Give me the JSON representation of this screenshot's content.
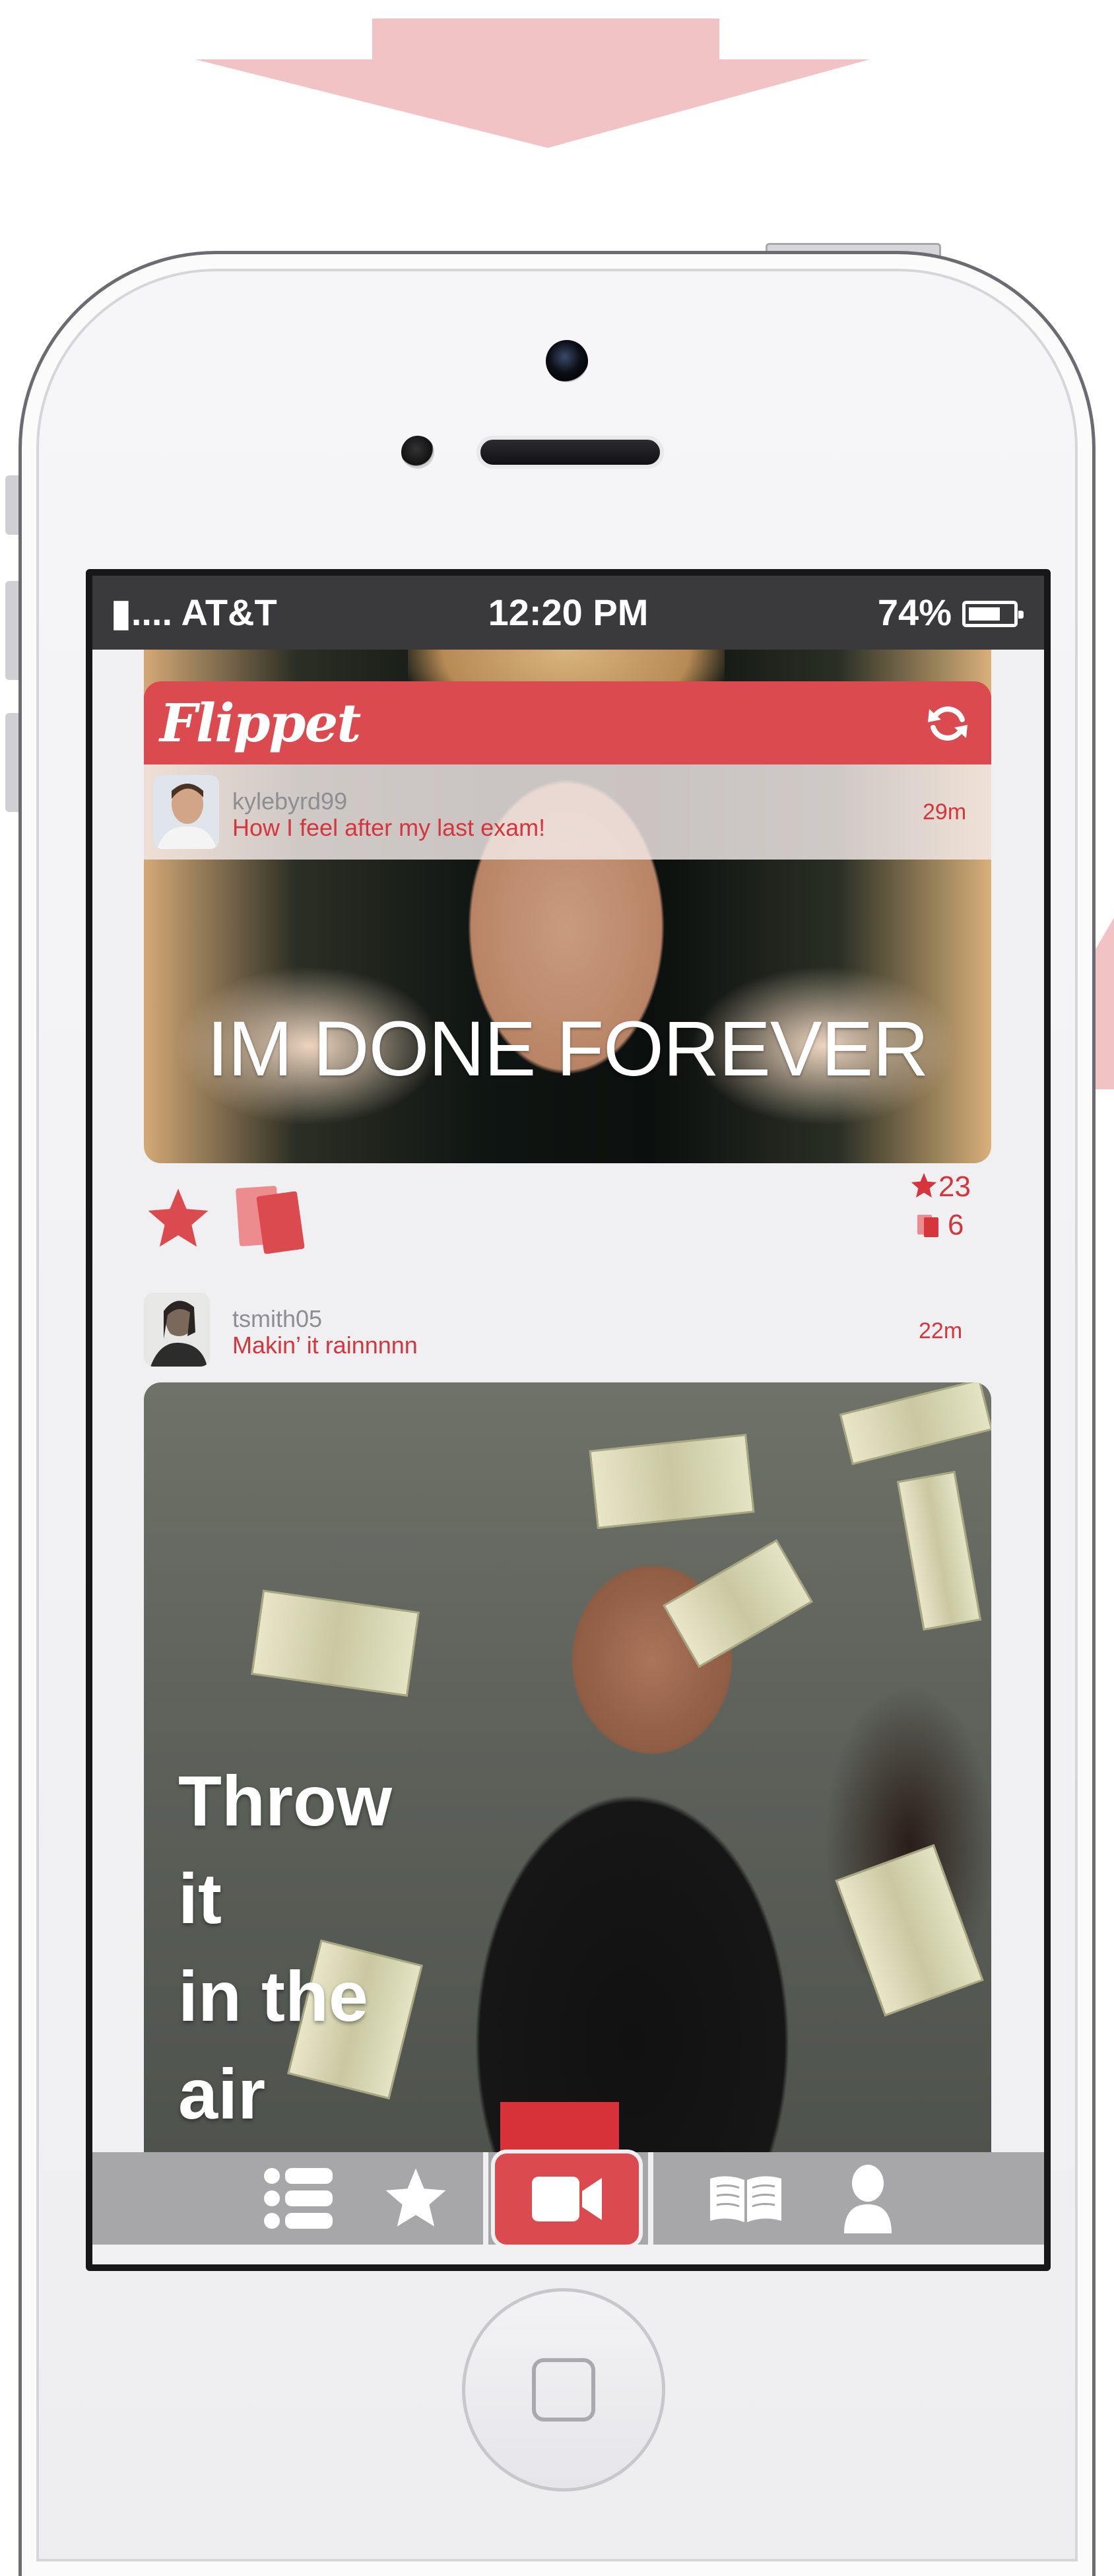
{
  "status_bar": {
    "carrier": "▮.... AT&T",
    "time": "12:20 PM",
    "battery_percent": "74%",
    "battery_level": 0.74
  },
  "app": {
    "name": "Flippet",
    "refresh_icon": "refresh-icon"
  },
  "feed": [
    {
      "username": "kylebyrd99",
      "title": "How I feel after my last exam!",
      "time": "29m",
      "caption": "IM DONE FOREVER",
      "stars": "23",
      "flips": "6"
    },
    {
      "username": "tsmith05",
      "title": "Makin’ it rainnnnn",
      "time": "22m",
      "caption_lines": [
        "Throw",
        "it",
        "in the",
        "air"
      ]
    }
  ],
  "tab_bar": {
    "tabs": [
      "list-icon",
      "star-icon",
      "video-camera-icon",
      "book-icon",
      "profile-icon"
    ],
    "active": "video-camera-icon"
  },
  "colors": {
    "brand_red": "#db4a4e",
    "accent_text": "#d4363c",
    "tab_gray": "#a7a7aa",
    "arrow_pink": "#f2c3c4"
  }
}
